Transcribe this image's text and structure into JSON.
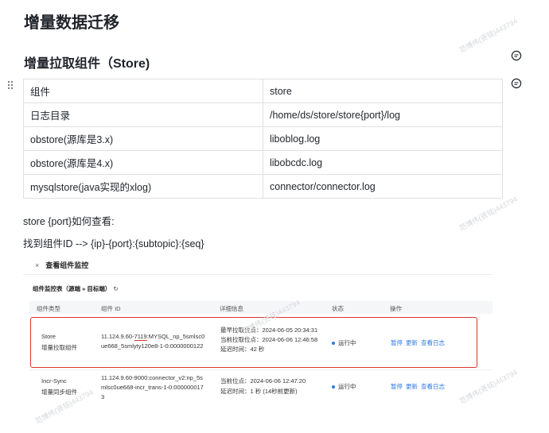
{
  "doc": {
    "title": "增量数据迁移",
    "section_title": "增量拉取组件（Store)",
    "table_rows": [
      {
        "key": "组件",
        "value": "store"
      },
      {
        "key": "日志目录",
        "value": "/home/ds/store/store{port}/log"
      },
      {
        "key": "obstore(源库是3.x)",
        "value": "liboblog.log"
      },
      {
        "key": "obstore(源库是4.x)",
        "value": "libobcdc.log"
      },
      {
        "key": "mysqlstore(java实现的xlog)",
        "value": "connector/connector.log"
      }
    ],
    "para1": "store {port}如何查看:",
    "para2": "找到组件ID --> {ip}-{port}:{subtopic}:{seq}"
  },
  "screenshot": {
    "close_glyph": "×",
    "header_title": "查看组件监控",
    "subheader": "组件监控表（源端 » 目标端）",
    "refresh_glyph": "↻",
    "columns": [
      "组件类型",
      "组件 ID",
      "详细信息",
      "状态",
      "操作"
    ],
    "rows": [
      {
        "type": "Store",
        "type_sub": "增量拉取组件",
        "id_prefix": "11.124.9.60-",
        "id_port": "7119",
        "id_rest": ":MYSQL_np_5smlsc0",
        "id_line2": "ue668_5smlyty120e8-1-0:0000000122",
        "detail1": "最早拉取位点：2024-06-05 20:34:31",
        "detail2": "当前拉取位点：2024-06-06 12:46:58",
        "detail3": "延迟时间：42 秒",
        "status": "运行中",
        "actions": [
          "暂停",
          "更新",
          "查看日志"
        ]
      },
      {
        "type": "Incr-Sync",
        "type_sub": "增量同步组件",
        "id_line1": "11.124.9.60-9000:connector_v2:np_5s",
        "id_line2": "mlsc0ue668-incr_trans-1-0:000000017",
        "id_line3": "3",
        "detail1": "当前位点：2024-06-06 12:47:20",
        "detail2": "延迟时间：1 秒 (14秒前更新)",
        "status": "运行中",
        "actions": [
          "暂停",
          "更新",
          "查看日志"
        ]
      }
    ]
  },
  "watermarks": [
    "范博伟(贤铭)443794",
    "范博伟(贤铭)443794",
    "范博伟(贤铭)443794",
    "范博伟(贤铭)443794",
    "范博伟(贤铭)443794"
  ],
  "colors": {
    "accent": "#2f7ae5",
    "highlight": "#e0322c",
    "border": "#dee0e3"
  }
}
